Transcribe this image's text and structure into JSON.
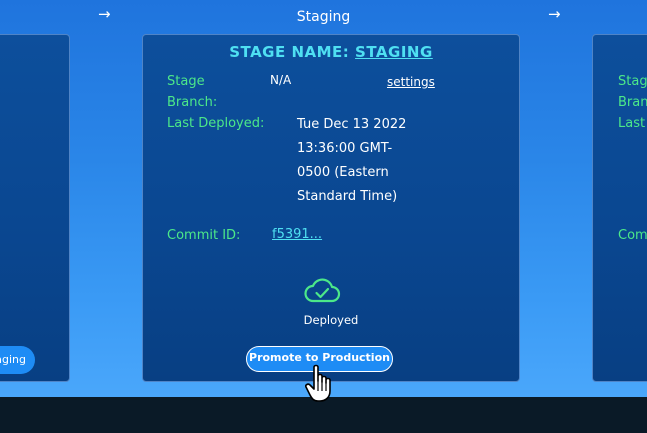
{
  "header": {
    "stage_heading": "Staging",
    "arrow_left": "→",
    "arrow_right": "→"
  },
  "card": {
    "title_prefix": "STAGE NAME:",
    "title_name": "STAGING",
    "stage_branch_label_1": "Stage",
    "stage_branch_label_2": "Branch:",
    "stage_branch_value": "N/A",
    "settings_link": "settings",
    "last_deployed_label": "Last Deployed:",
    "last_deployed_lines": [
      "Tue Dec 13 2022",
      "13:36:00 GMT-",
      "0500 (Eastern",
      "Standard Time)"
    ],
    "commit_label": "Commit ID:",
    "commit_value": "f5391...",
    "status_icon": "cloud-check-icon",
    "status_text": "Deployed",
    "promote_button": "Promote to Production"
  },
  "left_card": {
    "button_partial": "aging"
  },
  "right_card": {
    "label_stage": "Stag",
    "label_branch": "Branc",
    "label_last": "Last",
    "label_commit": "Comm"
  },
  "colors": {
    "label_green": "#4ce889",
    "title_cyan": "#4fe0f2",
    "button_blue": "#1e8cf5"
  }
}
